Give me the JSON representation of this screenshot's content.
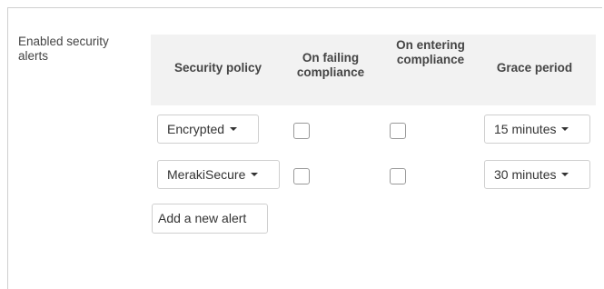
{
  "field": {
    "label": "Enabled security alerts"
  },
  "table": {
    "headers": {
      "policy": "Security policy",
      "failing": "On failing compliance",
      "entering": "On entering compliance",
      "grace": "Grace period"
    },
    "rows": [
      {
        "policy": "Encrypted",
        "on_failing_checked": false,
        "on_entering_checked": false,
        "grace": "15 minutes"
      },
      {
        "policy": "MerakiSecure",
        "on_failing_checked": false,
        "on_entering_checked": false,
        "grace": "30 minutes"
      }
    ]
  },
  "actions": {
    "add_alert_label": "Add a new alert"
  },
  "icons": {
    "dropdown": "caret-down-icon"
  }
}
